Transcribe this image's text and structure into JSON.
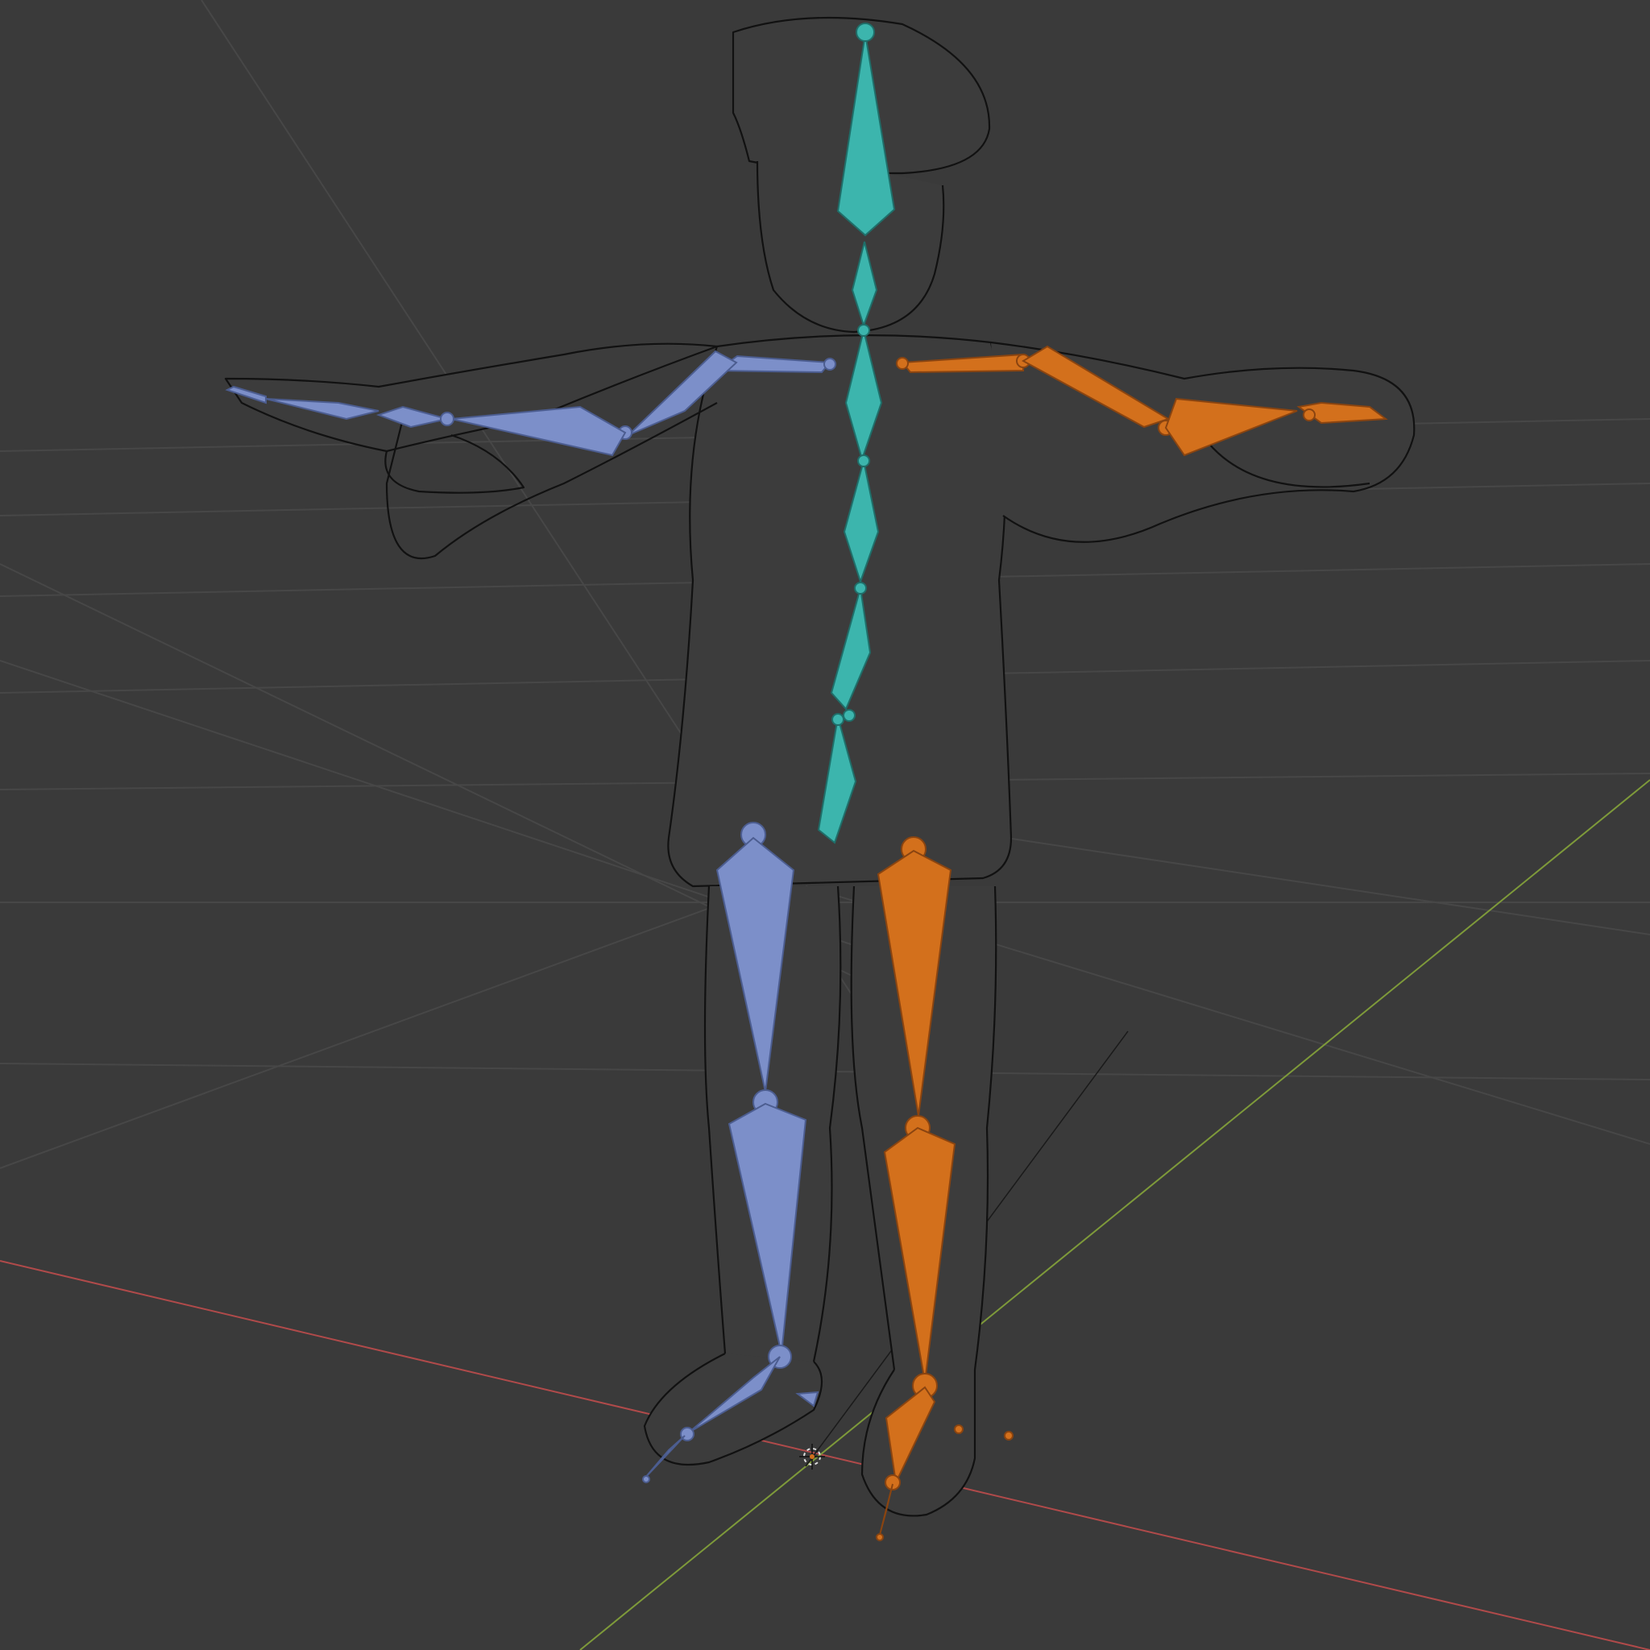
{
  "viewport": {
    "name": "3D Viewport",
    "background": "#3a3a3a",
    "grid_color": "#474747",
    "x_axis_color": "#b04a4a",
    "y_axis_color": "#7e9a3a"
  },
  "scene": {
    "object": "character-mesh",
    "display": "wireframe",
    "armature": {
      "center_color": "#3cb5ad",
      "left_color": "#7c8fc9",
      "right_color": "#d3701c"
    },
    "cursor_icon": "3d-cursor-icon"
  }
}
